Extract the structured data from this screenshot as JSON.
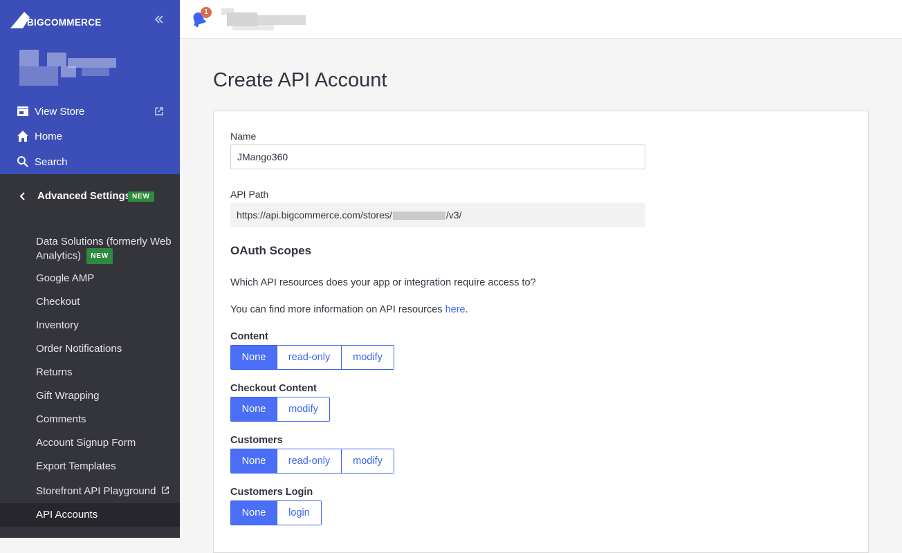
{
  "brand": {
    "logo_text": "BIGCOMMERCE",
    "sidebar_color": "#3c4fb8",
    "accent": "#3c64f4"
  },
  "sidebar": {
    "collapse_icon": "double-chevron-left-icon",
    "top_items": [
      {
        "label": "View Store",
        "icon": "storefront-icon",
        "external": true
      },
      {
        "label": "Home",
        "icon": "home-icon"
      },
      {
        "label": "Search",
        "icon": "search-icon"
      }
    ],
    "section": {
      "label": "Advanced Settings",
      "badge": "NEW",
      "icon": "chevron-left-icon"
    },
    "sub_items": [
      {
        "label": "Data Solutions (formerly Web Analytics)",
        "badge": "NEW"
      },
      {
        "label": "Google AMP"
      },
      {
        "label": "Checkout"
      },
      {
        "label": "Inventory"
      },
      {
        "label": "Order Notifications"
      },
      {
        "label": "Returns"
      },
      {
        "label": "Gift Wrapping"
      },
      {
        "label": "Comments"
      },
      {
        "label": "Account Signup Form"
      },
      {
        "label": "Export Templates"
      },
      {
        "label": "Storefront API Playground",
        "external": true
      },
      {
        "label": "API Accounts",
        "active": true
      }
    ]
  },
  "topbar": {
    "notification_icon": "bell-icon",
    "notification_count": "1"
  },
  "main": {
    "title": "Create API Account",
    "name_label": "Name",
    "name_value": "JMango360",
    "api_path_label": "API Path",
    "api_path_prefix": "https://api.bigcommerce.com/stores/",
    "api_path_suffix": "/v3/",
    "oauth_title": "OAuth Scopes",
    "question": "Which API resources does your app or integration require access to?",
    "info_prefix": "You can find more information on API resources ",
    "info_link": "here",
    "info_suffix": ".",
    "scopes": [
      {
        "label": "Content",
        "options": [
          "None",
          "read-only",
          "modify"
        ],
        "selected": "None"
      },
      {
        "label": "Checkout Content",
        "options": [
          "None",
          "modify"
        ],
        "selected": "None"
      },
      {
        "label": "Customers",
        "options": [
          "None",
          "read-only",
          "modify"
        ],
        "selected": "None"
      },
      {
        "label": "Customers Login",
        "options": [
          "None",
          "login"
        ],
        "selected": "None"
      }
    ]
  }
}
